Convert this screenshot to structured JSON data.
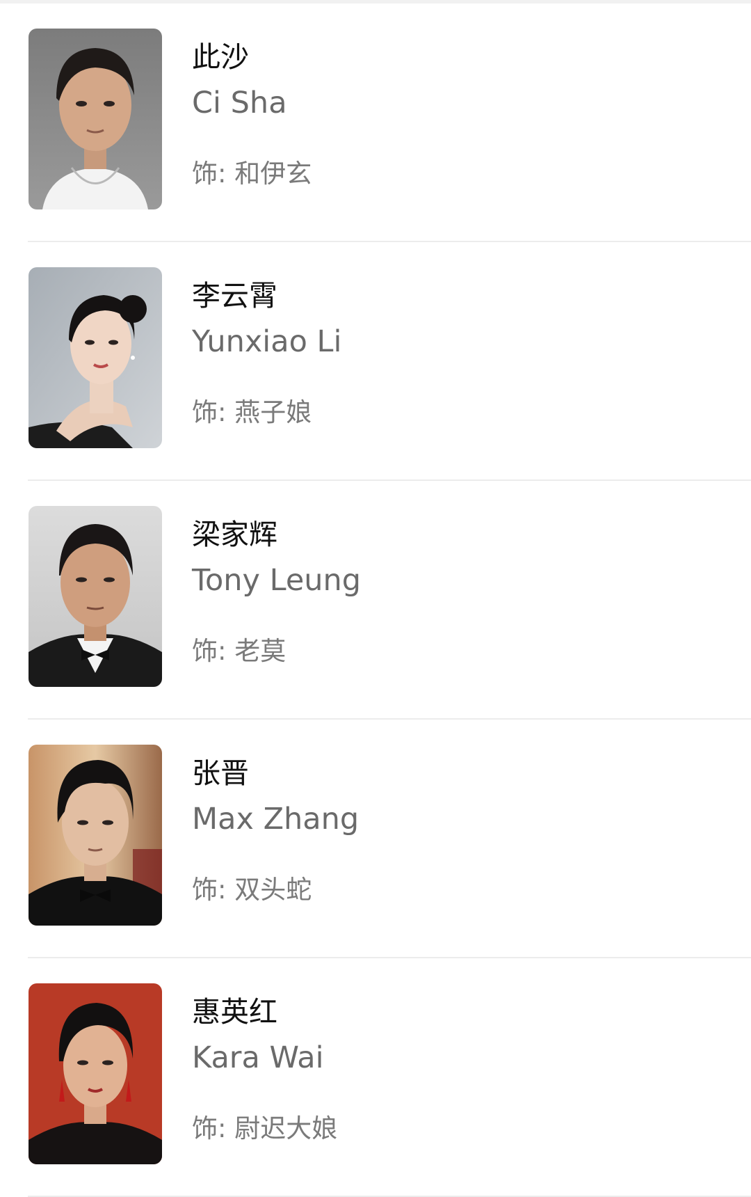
{
  "cast": [
    {
      "cn_name": "此沙",
      "en_name": "Ci Sha",
      "role_prefix": "饰: ",
      "role": "和伊玄"
    },
    {
      "cn_name": "李云霄",
      "en_name": "Yunxiao Li",
      "role_prefix": "饰: ",
      "role": "燕子娘"
    },
    {
      "cn_name": "梁家辉",
      "en_name": "Tony Leung",
      "role_prefix": "饰: ",
      "role": "老莫"
    },
    {
      "cn_name": "张晋",
      "en_name": "Max Zhang",
      "role_prefix": "饰: ",
      "role": "双头蛇"
    },
    {
      "cn_name": "惠英红",
      "en_name": "Kara Wai",
      "role_prefix": "饰: ",
      "role": "尉迟大娘"
    }
  ],
  "colors": {
    "name": "#111111",
    "english_name": "#6a6a6a",
    "role": "#7a7a7a",
    "divider": "#ececec"
  }
}
